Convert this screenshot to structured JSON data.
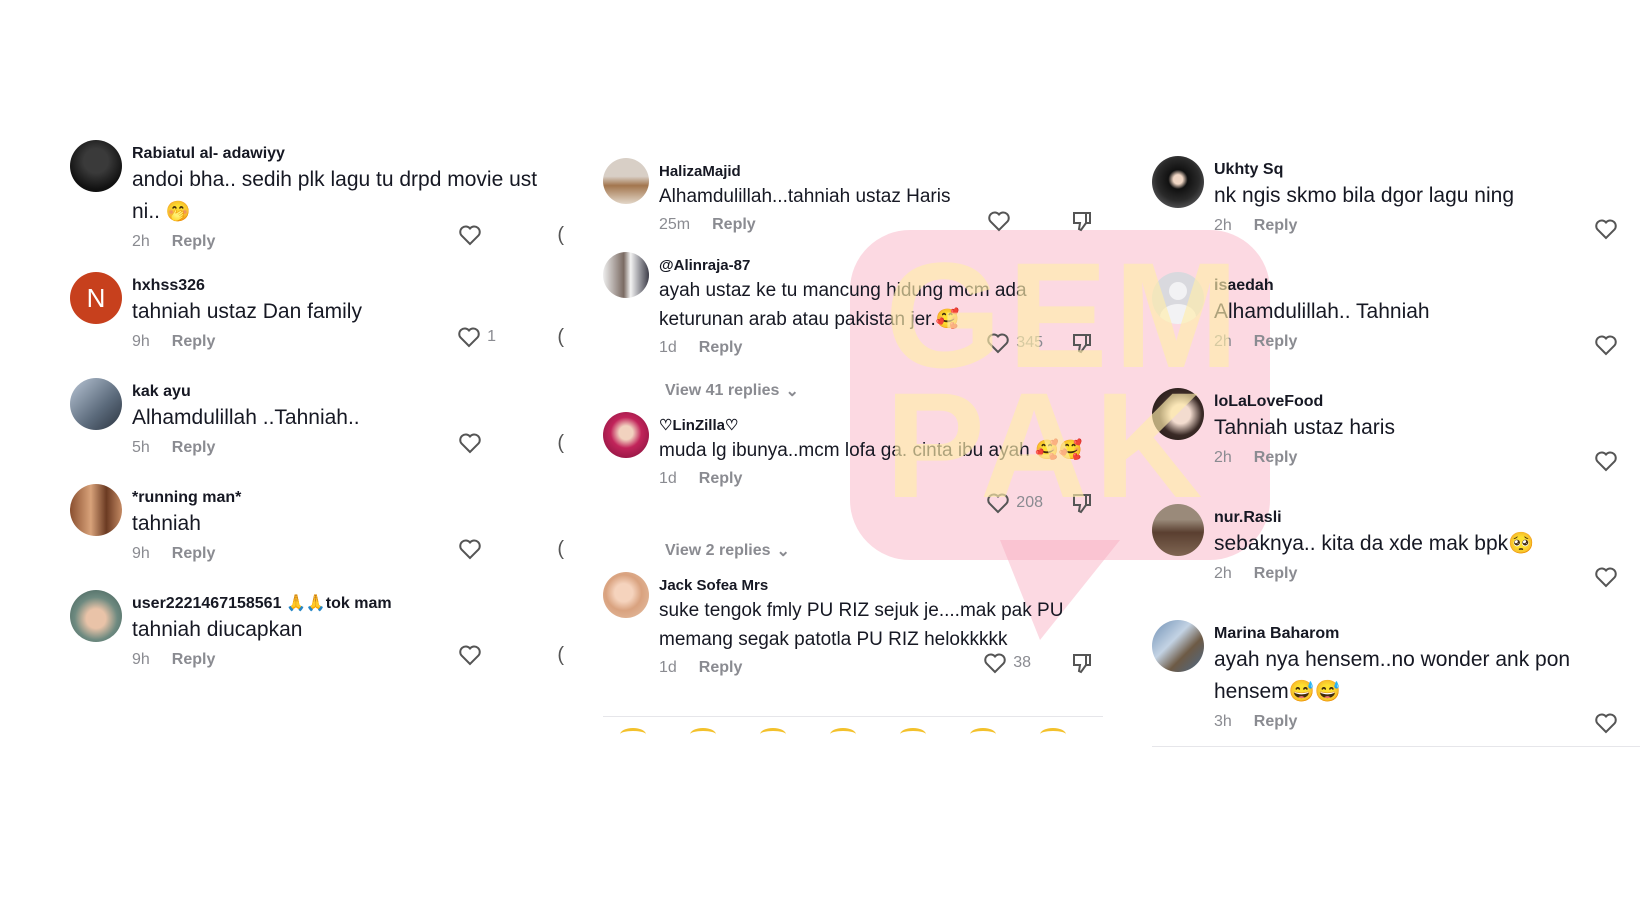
{
  "columns": [
    {
      "comments": [
        {
          "user": "Rabiatul al- adawiyy",
          "text": "andoi bha.. sedih plk lagu tu drpd movie ust ni..",
          "emoji": "🤭",
          "time": "2h",
          "reply": "Reply",
          "likes": ""
        },
        {
          "user": "hxhss326",
          "text": "tahniah ustaz Dan family",
          "time": "9h",
          "reply": "Reply",
          "likes": "1",
          "avatar_letter": "N"
        },
        {
          "user": "kak ayu",
          "text": "Alhamdulillah ..Tahniah..",
          "time": "5h",
          "reply": "Reply",
          "likes": ""
        },
        {
          "user": "*running man*",
          "text": "tahniah",
          "time": "9h",
          "reply": "Reply",
          "likes": ""
        },
        {
          "user": "user2221467158561",
          "user_suffix": "🙏🙏tok mam",
          "text": "tahniah diucapkan",
          "time": "9h",
          "reply": "Reply",
          "likes": ""
        }
      ]
    },
    {
      "comments": [
        {
          "user": "HalizaMajid",
          "text": "Alhamdulillah...tahniah ustaz Haris",
          "time": "25m",
          "reply": "Reply",
          "likes": ""
        },
        {
          "user": "@Alinraja-87",
          "text": "ayah ustaz ke tu mancung hidung mcm ada keturunan arab atau pakistan jer.🥰",
          "time": "1d",
          "reply": "Reply",
          "likes": "345",
          "view_replies": "View 41 replies"
        },
        {
          "user": "♡LinZilla♡",
          "text": "muda lg ibunya..mcm lofa ga. cinta ibu ayah 🥰🥰",
          "time": "1d",
          "reply": "Reply",
          "likes": "208",
          "view_replies": "View 2 replies"
        },
        {
          "user": "Jack Sofea Mrs",
          "text": "suke tengok fmly PU RIZ sejuk je....mak pak PU memang segak patotla PU RIZ helokkkkk",
          "time": "1d",
          "reply": "Reply",
          "likes": "38"
        }
      ]
    },
    {
      "comments": [
        {
          "user": "Ukhty Sq",
          "text": "nk ngis skmo bila dgor lagu ning",
          "time": "2h",
          "reply": "Reply",
          "likes": ""
        },
        {
          "user": "isaedah",
          "text": "Alhamdulillah.. Tahniah",
          "time": "2h",
          "reply": "Reply",
          "likes": ""
        },
        {
          "user": "loLaLoveFood",
          "text": "Tahniah ustaz haris",
          "time": "2h",
          "reply": "Reply",
          "likes": ""
        },
        {
          "user": "nur.Rasli",
          "text": "sebaknya.. kita da xde mak bpk🥺",
          "time": "2h",
          "reply": "Reply",
          "likes": ""
        },
        {
          "user": "Marina Baharom",
          "text": "ayah nya hensem..no wonder ank pon hensem😅😅",
          "time": "3h",
          "reply": "Reply",
          "likes": ""
        }
      ]
    }
  ],
  "watermark": {
    "text": "GEMPAK",
    "color": "#f8aabe"
  },
  "colors": {
    "text": "#161823",
    "muted": "#8a8b91",
    "accent": "#c7401d"
  }
}
